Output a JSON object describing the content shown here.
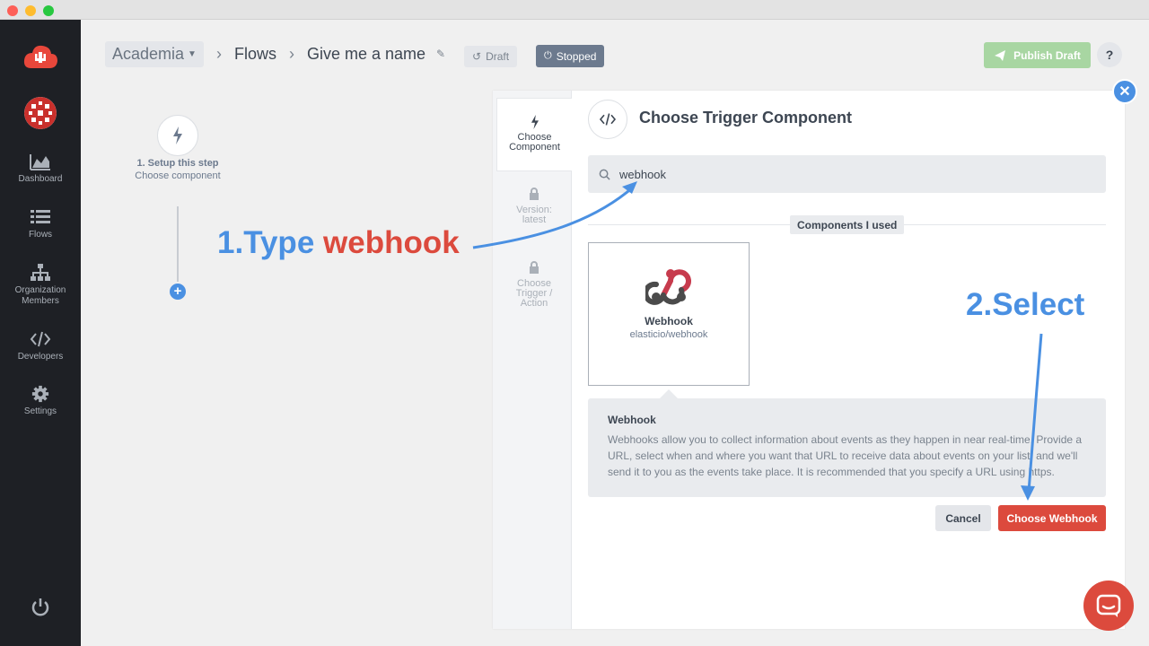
{
  "sidebar": {
    "items": [
      {
        "label": "Dashboard"
      },
      {
        "label": "Flows"
      },
      {
        "label": "Organization Members"
      },
      {
        "label": "Developers"
      },
      {
        "label": "Settings"
      }
    ]
  },
  "header": {
    "org": "Academia",
    "section": "Flows",
    "flow_name": "Give me a name",
    "draft_label": "Draft",
    "stopped_label": "Stopped",
    "publish_label": "Publish Draft",
    "help_label": "?"
  },
  "flow": {
    "step_title": "1. Setup this step",
    "step_subtitle": "Choose component"
  },
  "panel": {
    "tabs": [
      {
        "label": "Choose Component"
      },
      {
        "label": "Version: latest"
      },
      {
        "label": "Choose Trigger / Action"
      }
    ],
    "title": "Choose Trigger Component",
    "search_value": "webhook",
    "section_label": "Components I used",
    "component": {
      "name": "Webhook",
      "id": "elasticio/webhook"
    },
    "description": {
      "title": "Webhook",
      "text": "Webhooks allow you to collect information about events as they happen in near real-time. Provide a URL, select when and where you want that URL to receive data about events on your list, and we'll send it to you as the events take place. It is recommended that you specify a URL using https."
    },
    "cancel_label": "Cancel",
    "choose_label": "Choose Webhook"
  },
  "annotations": {
    "type_prefix": "1.Type ",
    "type_keyword": "webhook",
    "select": "2.Select"
  },
  "colors": {
    "accent_blue": "#4a90e2",
    "accent_red": "#dc4a3d",
    "publish_green": "#a8d6a2",
    "sidebar_bg": "#1e2025"
  }
}
